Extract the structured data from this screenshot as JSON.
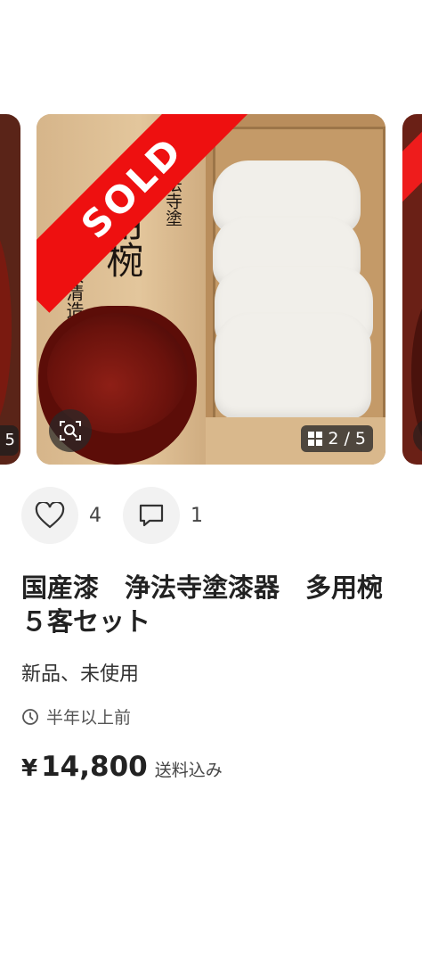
{
  "carousel": {
    "prev_badge": "5",
    "sold_label": "SOLD",
    "box_label_small": "浄法寺塗",
    "box_label_large": "多用椀",
    "box_label_maker": "大清造",
    "counter": "2 / 5",
    "icons": [
      "search-zoom-icon",
      "grid-icon"
    ]
  },
  "actions": {
    "likes": "4",
    "comments": "1",
    "icons": [
      "heart-icon",
      "comment-icon"
    ]
  },
  "item": {
    "title": "国産漆　浄法寺塗漆器　多用椀５客セット",
    "condition": "新品、未使用",
    "posted": "半年以上前",
    "currency": "¥",
    "price": "14,800",
    "shipping": "送料込み"
  },
  "colors": {
    "sold_red": "#ee1010",
    "lacquer": "#6a120c"
  }
}
